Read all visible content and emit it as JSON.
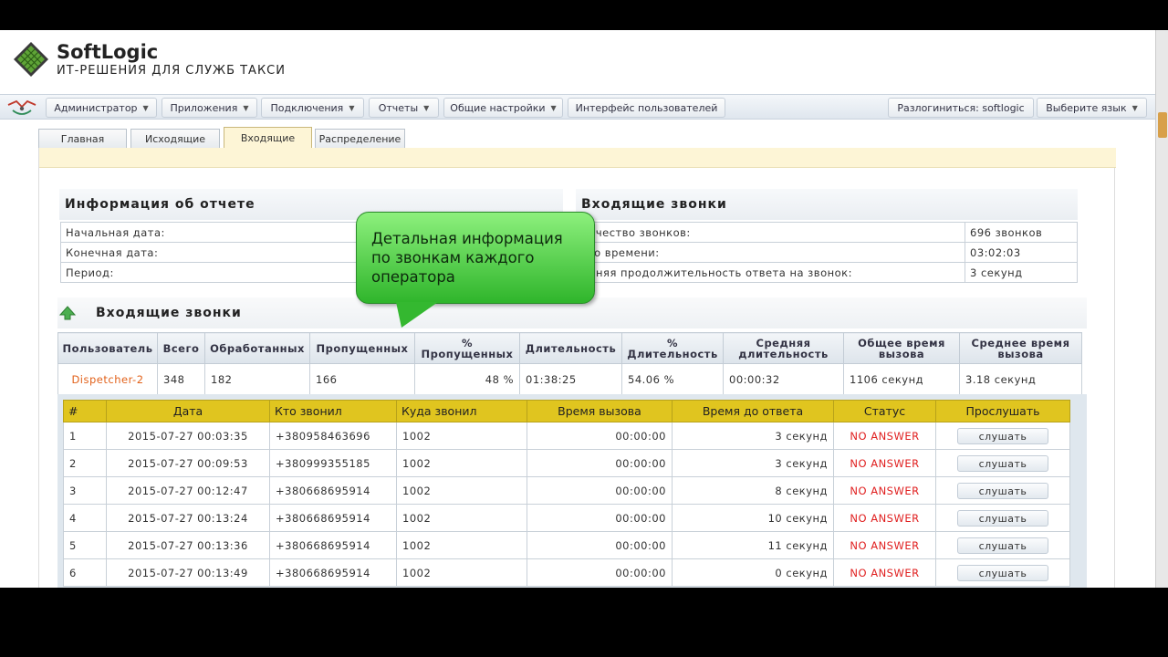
{
  "brand": {
    "name": "SoftLogic",
    "tagline": "ИТ-РЕШЕНИЯ ДЛЯ СЛУЖБ ТАКСИ"
  },
  "nav": {
    "items": [
      {
        "label": "Администратор",
        "caret": "▼"
      },
      {
        "label": "Приложения",
        "caret": "▼"
      },
      {
        "label": "Подключения",
        "caret": "▼"
      },
      {
        "label": "Отчеты",
        "caret": "▼"
      },
      {
        "label": "Общие настройки",
        "caret": "▼"
      },
      {
        "label": "Интерфейс пользователей",
        "caret": ""
      }
    ],
    "logout": "Разлогиниться: softlogic",
    "language": {
      "label": "Выберите язык",
      "caret": "▼"
    }
  },
  "tabs": [
    {
      "label": "Главная"
    },
    {
      "label": "Исходящие"
    },
    {
      "label": "Входящие",
      "active": true
    },
    {
      "label": "Распределение"
    }
  ],
  "report_info": {
    "title": "Информация об отчете",
    "rows": [
      {
        "label": "Начальная дата:",
        "value": ""
      },
      {
        "label": "Конечная дата:",
        "value": ""
      },
      {
        "label": "Период:",
        "value": ""
      }
    ]
  },
  "incoming_info": {
    "title": "Входящие звонки",
    "rows": [
      {
        "label": "личество звонков:",
        "value": "696 звонков"
      },
      {
        "label": "его времени:",
        "value": "03:02:03"
      },
      {
        "label": "едняя продолжительность ответа на звонок:",
        "value": "3 секунд"
      }
    ]
  },
  "callout": {
    "text": "Детальная информация по звонкам каждого оператора"
  },
  "summary": {
    "title": "Входящие звонки",
    "headers": [
      "Пользователь",
      "Всего",
      "Обработанных",
      "Пропущенных",
      "% Пропущенных",
      "Длительность",
      "% Длительность",
      "Средняя длительность",
      "Общее время вызова",
      "Среднее время вызова"
    ],
    "row": {
      "user": "Dispetcher-2",
      "total": "348",
      "handled": "182",
      "missed": "166",
      "missed_pct": "48 %",
      "duration": "01:38:25",
      "duration_pct": "54.06 %",
      "avg_duration": "00:00:32",
      "total_call_time": "1106 секунд",
      "avg_call_time": "3.18 секунд"
    }
  },
  "detail": {
    "headers": [
      "#",
      "Дата",
      "Кто звонил",
      "Куда звонил",
      "Время вызова",
      "Время до ответа",
      "Статус",
      "Прослушать"
    ],
    "rows": [
      {
        "n": "1",
        "date": "2015-07-27 00:03:35",
        "from": "+380958463696",
        "to": "1002",
        "call_time": "00:00:00",
        "wait": "3 секунд",
        "status": "NO ANSWER",
        "listen": "слушать"
      },
      {
        "n": "2",
        "date": "2015-07-27 00:09:53",
        "from": "+380999355185",
        "to": "1002",
        "call_time": "00:00:00",
        "wait": "3 секунд",
        "status": "NO ANSWER",
        "listen": "слушать"
      },
      {
        "n": "3",
        "date": "2015-07-27 00:12:47",
        "from": "+380668695914",
        "to": "1002",
        "call_time": "00:00:00",
        "wait": "8 секунд",
        "status": "NO ANSWER",
        "listen": "слушать"
      },
      {
        "n": "4",
        "date": "2015-07-27 00:13:24",
        "from": "+380668695914",
        "to": "1002",
        "call_time": "00:00:00",
        "wait": "10 секунд",
        "status": "NO ANSWER",
        "listen": "слушать"
      },
      {
        "n": "5",
        "date": "2015-07-27 00:13:36",
        "from": "+380668695914",
        "to": "1002",
        "call_time": "00:00:00",
        "wait": "11 секунд",
        "status": "NO ANSWER",
        "listen": "слушать"
      },
      {
        "n": "6",
        "date": "2015-07-27 00:13:49",
        "from": "+380668695914",
        "to": "1002",
        "call_time": "00:00:00",
        "wait": "0 секунд",
        "status": "NO ANSWER",
        "listen": "слушать"
      }
    ]
  },
  "colors": {
    "accent_yellow": "#e0c51f",
    "status_red": "#e02020",
    "user_orange": "#e2621b",
    "callout_green": "#2fb52b"
  }
}
